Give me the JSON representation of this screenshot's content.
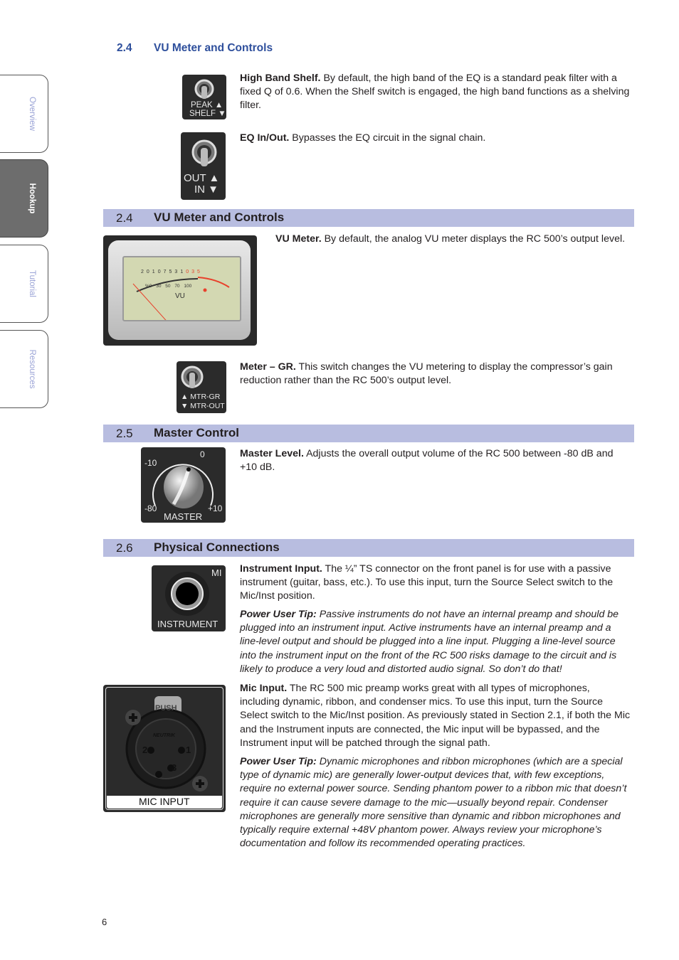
{
  "side_tabs": [
    {
      "label": "Overview",
      "active": false
    },
    {
      "label": "Hookup",
      "active": true
    },
    {
      "label": "Tutorial",
      "active": false
    },
    {
      "label": "Resources",
      "active": false
    }
  ],
  "top_heading": {
    "number": "2.4",
    "title": "VU Meter and Controls"
  },
  "items_top": [
    {
      "switch": {
        "top_label": "PEAK ▲",
        "bottom_label": "SHELF ▼"
      },
      "term": "High Band Shelf.",
      "text": " By default, the high band of the EQ is a standard peak filter with a fixed Q of 0.6. When the Shelf switch is engaged, the high band functions as a shelving filter."
    },
    {
      "switch": {
        "top_label": "OUT ▲",
        "bottom_label": "IN ▼"
      },
      "term": "EQ In/Out.",
      "text": " Bypasses the EQ circuit in the signal chain."
    }
  ],
  "sections": [
    {
      "number": "2.4",
      "title": "VU Meter and Controls",
      "items": [
        {
          "term": "VU Meter.",
          "text": " By default, the analog VU meter displays the RC 500’s output level.",
          "meter": {
            "top_scale": [
              "20",
              "10",
              "7",
              "5",
              "3",
              "1",
              "0",
              "3",
              "5"
            ],
            "bottom_scale": [
              "%0",
              "30",
              "50",
              "70",
              "100"
            ],
            "minus": "−",
            "plus": "+",
            "label": "VU"
          }
        },
        {
          "term": "Meter – GR.",
          "text": " This switch changes the VU metering to display the compressor’s gain reduction rather than the RC 500’s output level.",
          "switch": {
            "top_label": "▲ MTR-GR",
            "bottom_label": "▼ MTR-OUT"
          }
        }
      ]
    },
    {
      "number": "2.5",
      "title": "Master Control",
      "items": [
        {
          "term": "Master Level.",
          "text": " Adjusts the overall output volume of the RC 500 between -80 dB and +10 dB.",
          "knob": {
            "labels": [
              "-10",
              "0",
              "-80",
              "+10"
            ],
            "name": "MASTER"
          }
        }
      ]
    },
    {
      "number": "2.6",
      "title": "Physical Connections",
      "items": [
        {
          "term": "Instrument Input.",
          "text": " The ¼” TS connector on the front panel is for use with a passive instrument (guitar, bass, etc.). To use this input, turn the Source Select switch to the Mic/Inst position.",
          "tip_label": "Power User Tip:",
          "tip": " Passive instruments do not have an internal preamp and should be plugged into an instrument input. Active instruments have an internal preamp and a line-level output and should be plugged into a line input. Plugging a line-level source into the instrument input on the front of the RC 500 risks damage to the circuit and is likely to produce a very loud and distorted audio signal. So don’t do that!",
          "jack": {
            "label": "INSTRUMENT",
            "edge_label": "MI"
          }
        },
        {
          "term": "Mic Input.",
          "text": " The RC 500 mic preamp works great with all types of microphones, including dynamic, ribbon, and condenser mics. To use this input, turn the Source Select switch to the Mic/Inst position. As previously stated in Section 2.1, if both the Mic and the Instrument inputs are connected, the Mic input will be bypassed, and the Instrument input will be patched through the signal path.",
          "tip_label": "Power User Tip:",
          "tip": " Dynamic microphones and ribbon microphones (which are a special type of dynamic mic) are generally lower-output devices that, with few exceptions, require no external power source. Sending phantom power to a ribbon mic that doesn’t require it can cause severe damage to the mic—usually beyond repair. Condenser microphones are generally more sensitive than dynamic and ribbon microphones and typically require external +48V phantom power. Always review your microphone’s documentation and follow its recommended operating practices.",
          "xlr": {
            "label": "MIC INPUT",
            "push": "PUSH",
            "brand": "NEUTRIK",
            "pins": [
              "2",
              "1",
              "3"
            ]
          }
        }
      ]
    }
  ],
  "page_number": "6",
  "colors": {
    "heading_blue": "#2e4f9c",
    "section_bar": "#b8bde0",
    "tab_text": "#9aa3d6",
    "meter_red": "#e8412c"
  }
}
